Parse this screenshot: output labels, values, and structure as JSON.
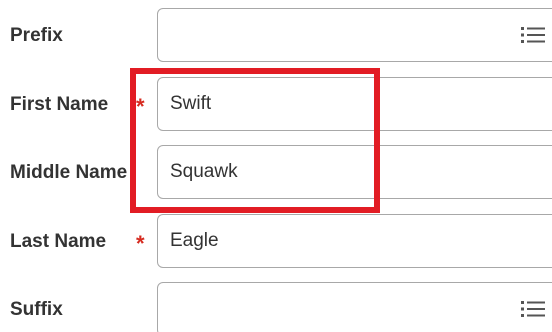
{
  "fields": [
    {
      "label": "Prefix",
      "value": "",
      "required": false
    },
    {
      "label": "First Name",
      "value": "Swift",
      "required": true
    },
    {
      "label": "Middle Name",
      "value": "Squawk",
      "required": false
    },
    {
      "label": "Last Name",
      "value": "Eagle",
      "required": true
    },
    {
      "label": "Suffix",
      "value": "",
      "required": false
    }
  ],
  "required_marker": "*",
  "icons": {
    "prompt": "list-icon"
  },
  "colors": {
    "required": "#d62b20",
    "highlight": "#e21c24",
    "border": "#a8a8a8"
  }
}
